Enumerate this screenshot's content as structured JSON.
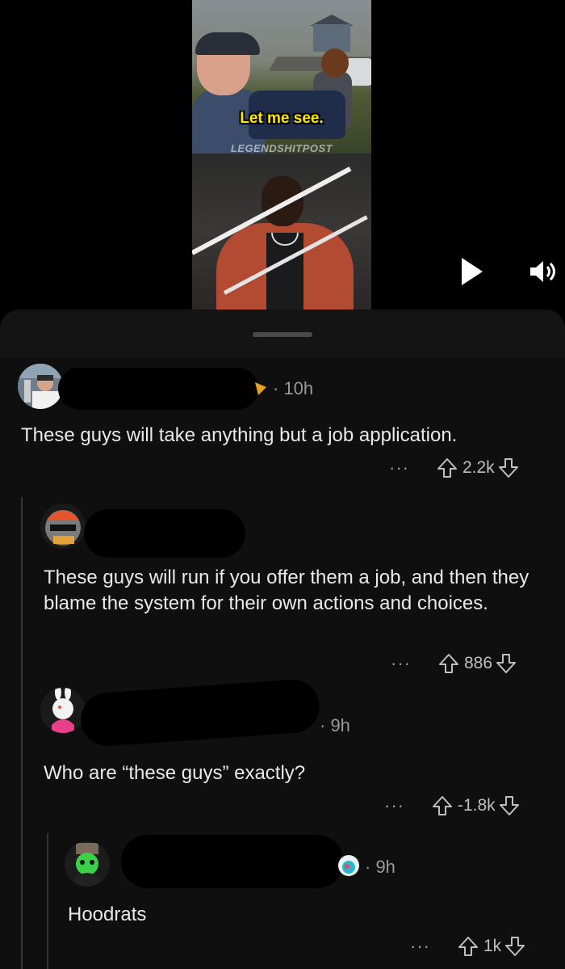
{
  "video": {
    "caption": "Let me see.",
    "watermark": "LEGENDSHITPOST",
    "controls": {
      "play_icon": "play-icon",
      "volume_icon": "volume-icon"
    }
  },
  "comments": [
    {
      "time": "· 10h",
      "text": "These guys will take anything but a job application.",
      "more": "···",
      "score": "2.2k"
    },
    {
      "text": "These guys will run if you offer them a job, and then they blame the system for their own actions and choices.",
      "more": "···",
      "score": "886"
    },
    {
      "time": "· 9h",
      "text": "Who are “these guys” exactly?",
      "more": "···",
      "score": "-1.8k"
    },
    {
      "time": "· 9h",
      "text": "Hoodrats",
      "more": "···",
      "score": "1k"
    }
  ],
  "colors": {
    "background": "#0f0f0f",
    "text": "#e9e9e9",
    "muted": "#9a9a9a",
    "caption": "#ffe600"
  }
}
